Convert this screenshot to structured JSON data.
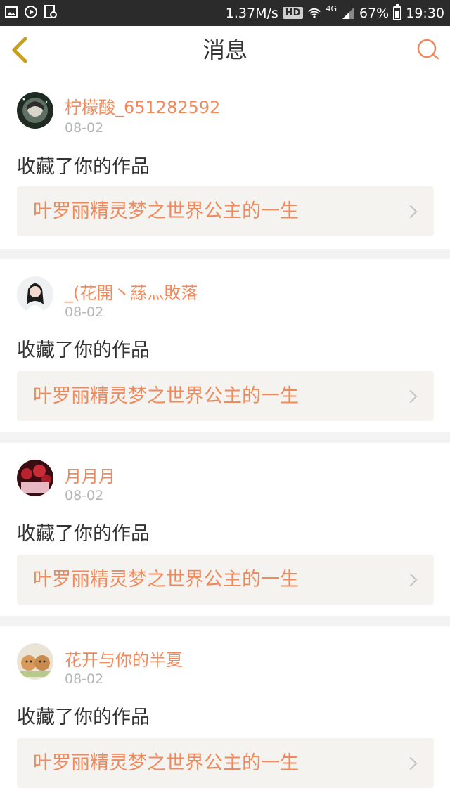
{
  "status_bar": {
    "speed": "1.37M/s",
    "hd": "HD",
    "network": "4G",
    "battery": "67%",
    "time": "19:30",
    "icons": [
      "image-icon",
      "play-icon",
      "screenshot-icon",
      "wifi-icon",
      "signal-icon",
      "battery-icon"
    ]
  },
  "header": {
    "title": "消息",
    "back_icon": "chevron-left-icon",
    "search_icon": "search-icon"
  },
  "colors": {
    "accent": "#f08a5d",
    "back_icon": "#c8a020",
    "text_dark": "#333333",
    "text_muted": "#b5b5b5",
    "work_box_bg": "#f4f3ef",
    "page_bg": "#f3f3f3"
  },
  "messages": [
    {
      "username": "柠檬酸_651282592",
      "date": "08-02",
      "action": "收藏了你的作品",
      "work_title": "叶罗丽精灵梦之世界公主的一生"
    },
    {
      "username": "_(花開丶蕬灬敗落",
      "date": "08-02",
      "action": "收藏了你的作品",
      "work_title": "叶罗丽精灵梦之世界公主的一生"
    },
    {
      "username": "月月月",
      "date": "08-02",
      "action": "收藏了你的作品",
      "work_title": "叶罗丽精灵梦之世界公主的一生"
    },
    {
      "username": "花开与你的半夏",
      "date": "08-02",
      "action": "收藏了你的作品",
      "work_title": "叶罗丽精灵梦之世界公主的一生"
    }
  ]
}
